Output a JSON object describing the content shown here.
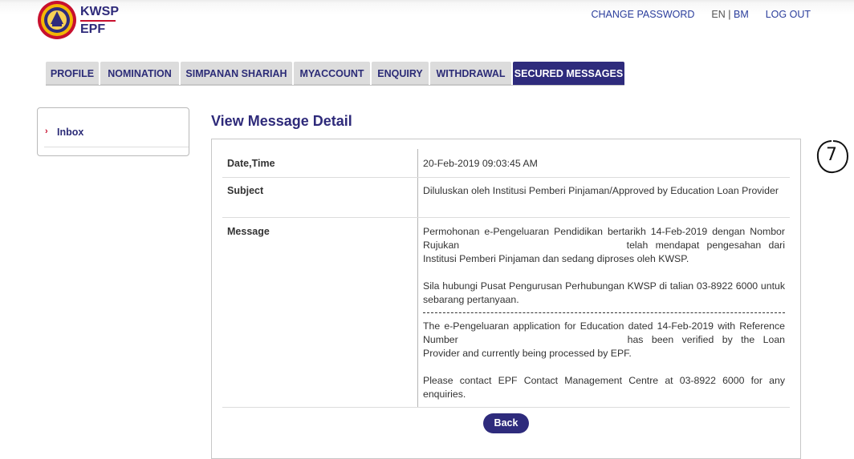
{
  "header": {
    "logo_line1": "KWSP",
    "logo_line2": "EPF",
    "links": {
      "change_password": "CHANGE PASSWORD",
      "lang_en": "EN",
      "lang_sep": "|",
      "lang_bm": "BM",
      "logout": "LOG OUT"
    }
  },
  "tabs": [
    {
      "label": "PROFILE"
    },
    {
      "label": "NOMINATION"
    },
    {
      "label": "SIMPANAN SHARIAH"
    },
    {
      "label": "MYACCOUNT"
    },
    {
      "label": "ENQUIRY"
    },
    {
      "label": "WITHDRAWAL"
    },
    {
      "label": "SECURED MESSAGES",
      "active": true
    }
  ],
  "sidebar": {
    "items": [
      {
        "label": "Inbox"
      }
    ]
  },
  "main": {
    "title": "View Message Detail",
    "rows": {
      "datetime_label": "Date,Time",
      "datetime_value": "20-Feb-2019 09:03:45 AM",
      "subject_label": "Subject",
      "subject_value": "Diluluskan oleh Institusi Pemberi Pinjaman/Approved by Education Loan Provider",
      "message_label": "Message"
    },
    "message": {
      "bm_p1_a": "Permohonan e-Pengeluaran Pendidikan bertarikh 14-Feb-2019 dengan Nombor Rujukan",
      "bm_p1_b": "telah mendapat pengesahan dari Institusi Pemberi Pinjaman dan sedang diproses oleh KWSP.",
      "bm_p2": "Sila hubungi Pusat Pengurusan Perhubungan KWSP di talian 03-8922 6000 untuk sebarang pertanyaan.",
      "en_p1_a": "The e-Pengeluaran application for Education dated 14-Feb-2019 with Reference Number",
      "en_p1_b": "has been verified by the Loan Provider and currently being processed by EPF.",
      "en_p2": "Please contact EPF Contact Management Centre at 03-8922 6000 for any enquiries."
    },
    "back_label": "Back"
  },
  "annotation": {
    "handwritten_number": "7"
  },
  "colors": {
    "brand_navy": "#2e2b7c",
    "link_blue": "#2a3d9c",
    "accent_red": "#c8102e",
    "tab_inactive": "#dcdcdc"
  }
}
